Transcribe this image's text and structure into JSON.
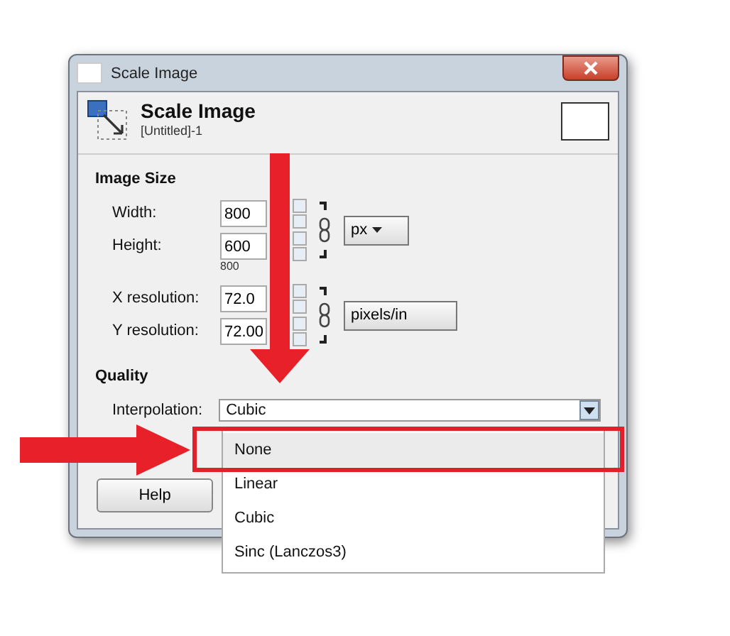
{
  "window": {
    "title": "Scale Image"
  },
  "header": {
    "title": "Scale Image",
    "subtitle": "[Untitled]-1"
  },
  "image_size": {
    "heading": "Image Size",
    "rows": [
      {
        "label": "Width:",
        "value": "800"
      },
      {
        "label": "Height:",
        "value": "600"
      }
    ],
    "size_hint": "800",
    "unit": "px",
    "res_rows": [
      {
        "label": "X resolution:",
        "value": "72.0"
      },
      {
        "label": "Y resolution:",
        "value": "72.00"
      }
    ],
    "res_unit": "pixels/in"
  },
  "quality": {
    "heading": "Quality",
    "label": "Interpolation:",
    "value": "Cubic",
    "options": [
      {
        "label": "None",
        "highlighted": true
      },
      {
        "label": "Linear",
        "highlighted": false
      },
      {
        "label": "Cubic",
        "highlighted": false
      },
      {
        "label": "Sinc (Lanczos3)",
        "highlighted": false
      }
    ]
  },
  "buttons": [
    "Help"
  ]
}
